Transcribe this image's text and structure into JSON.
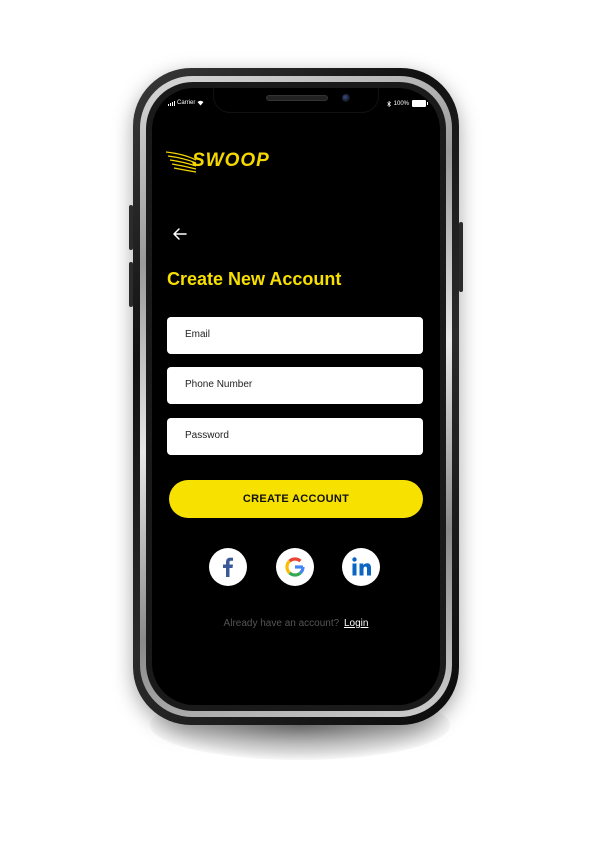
{
  "status_bar": {
    "carrier": "Carrier",
    "battery": "100%"
  },
  "brand": {
    "logo_text": "SWOOP",
    "accent_color": "#f7e100"
  },
  "nav": {
    "back_icon": "arrow-left-icon"
  },
  "page": {
    "title": "Create New Account"
  },
  "form": {
    "email_placeholder": "Email",
    "phone_placeholder": "Phone Number",
    "password_placeholder": "Password",
    "submit_label": "CREATE ACCOUNT"
  },
  "social": [
    {
      "name": "facebook",
      "icon": "facebook-icon"
    },
    {
      "name": "google",
      "icon": "google-icon"
    },
    {
      "name": "linkedin",
      "icon": "linkedin-icon"
    }
  ],
  "footer": {
    "prompt": "Already have an account?",
    "login_label": "Login"
  }
}
